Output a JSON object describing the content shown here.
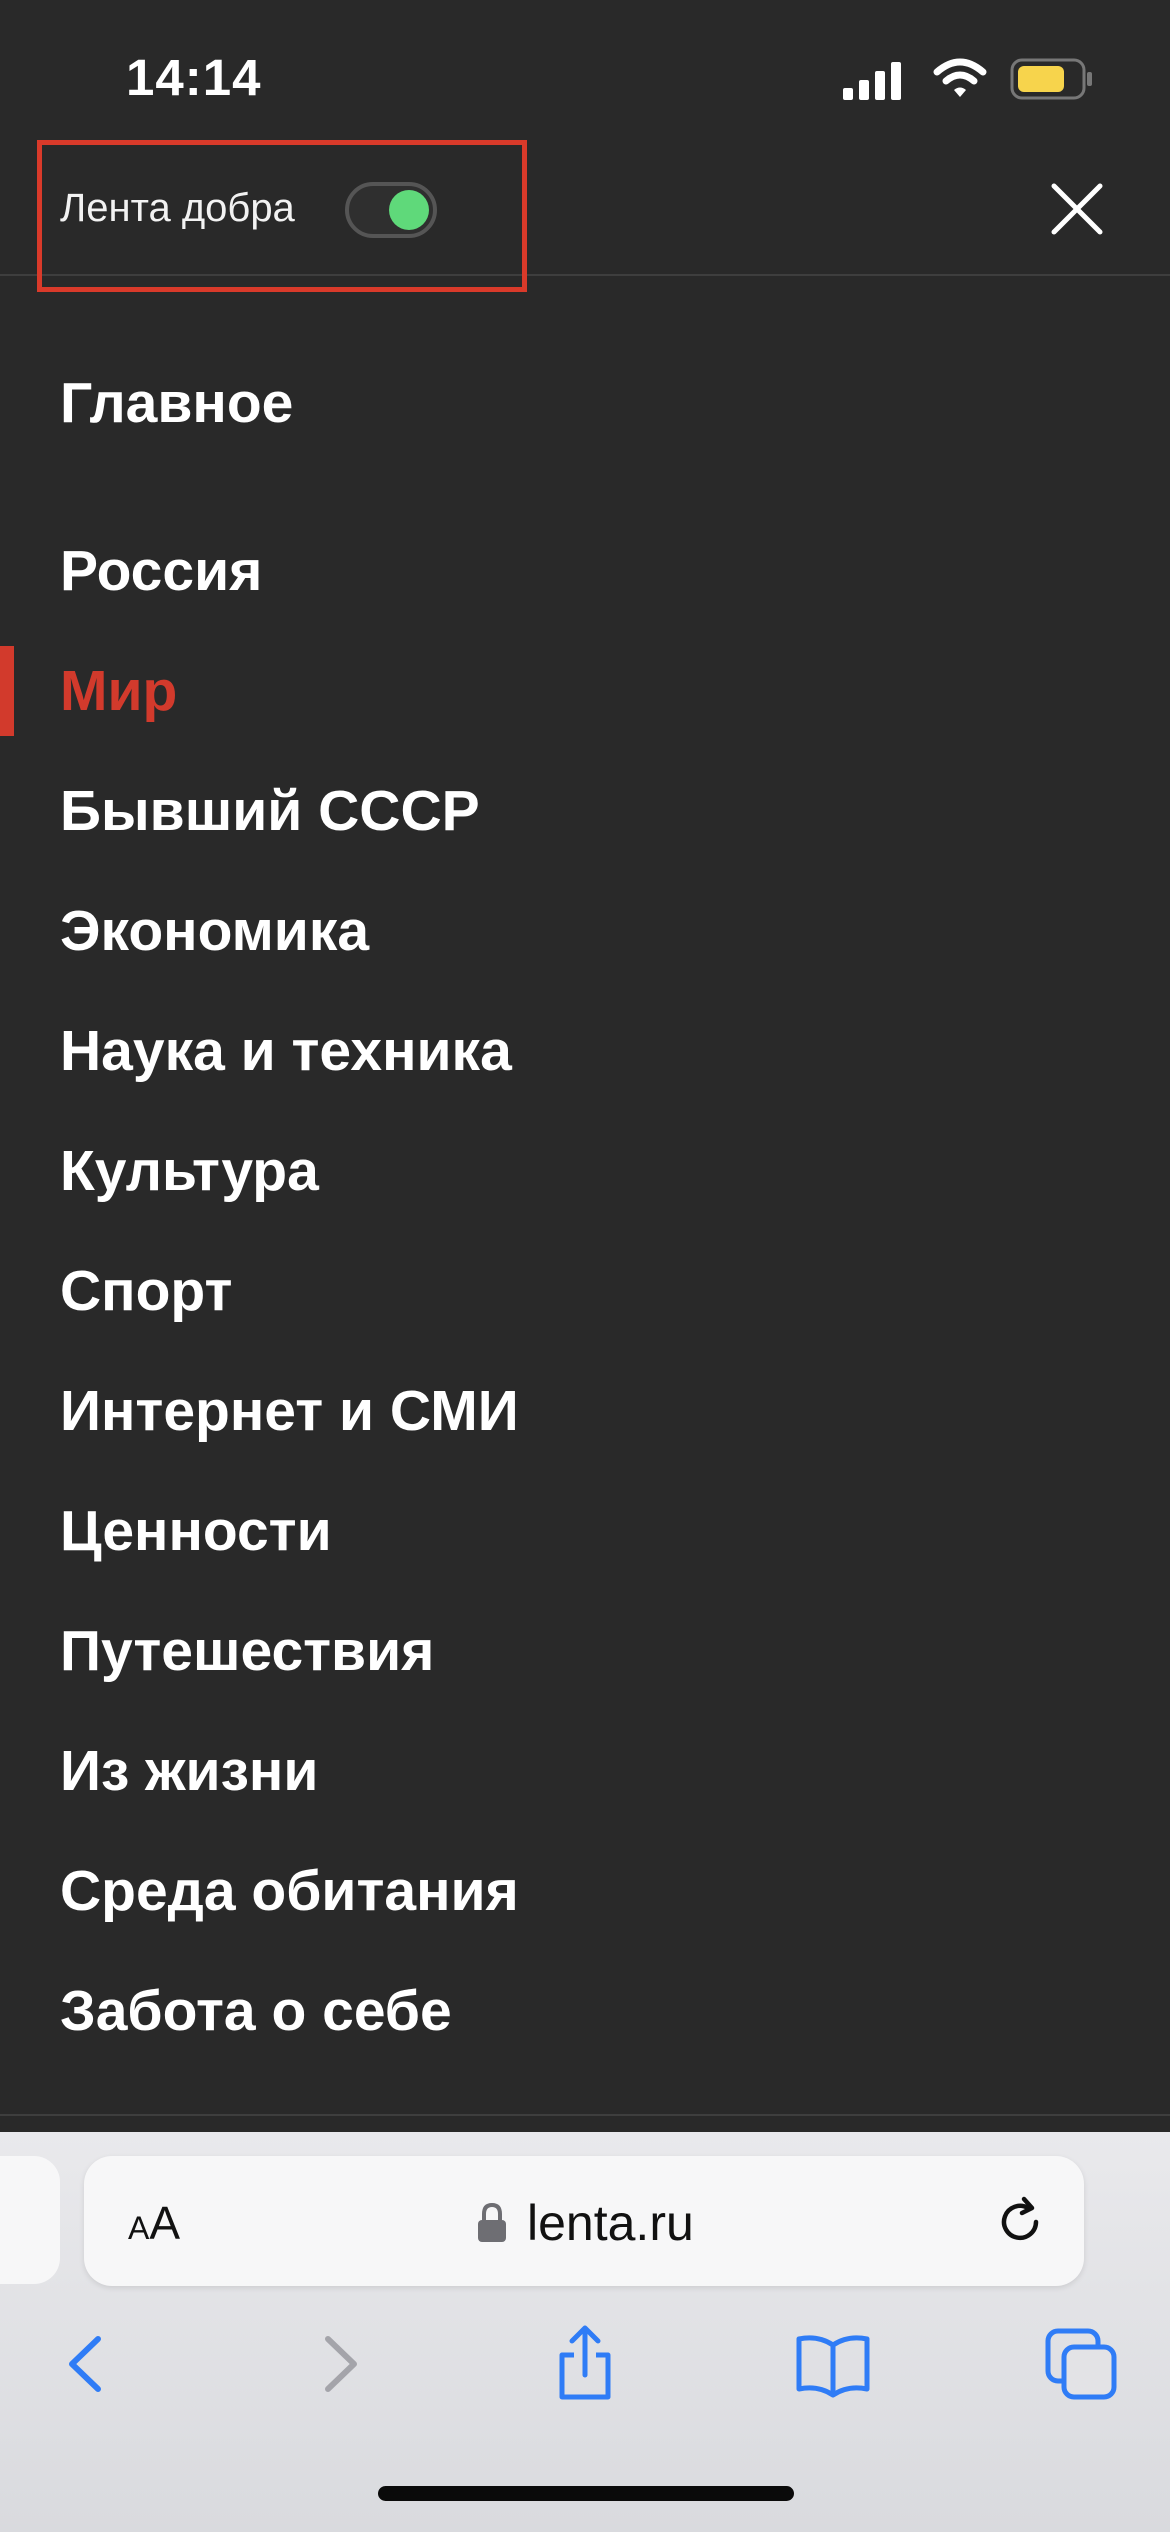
{
  "status_bar": {
    "time": "14:14",
    "icons": [
      "signal-icon",
      "wifi-icon",
      "battery-icon"
    ],
    "battery_color": "#f7d44c"
  },
  "menu_header": {
    "toggle_label": "Лента добра",
    "toggle_state": "on",
    "toggle_color": "#5fd97a",
    "highlight_color": "#d93a2a",
    "close_icon": "close-icon"
  },
  "menu": {
    "main_item": "Главное",
    "items": [
      {
        "label": "Россия",
        "active": false
      },
      {
        "label": "Мир",
        "active": true
      },
      {
        "label": "Бывший СССР",
        "active": false
      },
      {
        "label": "Экономика",
        "active": false
      },
      {
        "label": "Наука и техника",
        "active": false
      },
      {
        "label": "Культура",
        "active": false
      },
      {
        "label": "Спорт",
        "active": false
      },
      {
        "label": "Интернет и СМИ",
        "active": false
      },
      {
        "label": "Ценности",
        "active": false
      },
      {
        "label": "Путешествия",
        "active": false
      },
      {
        "label": "Из жизни",
        "active": false
      },
      {
        "label": "Среда обитания",
        "active": false
      },
      {
        "label": "Забота о себе",
        "active": false
      }
    ],
    "active_color": "#d23a2c"
  },
  "browser": {
    "aa_small": "A",
    "aa_big": "A",
    "url": "lenta.ru",
    "accent_color": "#2f7cf6",
    "toolbar": [
      "back-icon",
      "forward-icon",
      "share-icon",
      "bookmarks-icon",
      "tabs-icon"
    ]
  }
}
